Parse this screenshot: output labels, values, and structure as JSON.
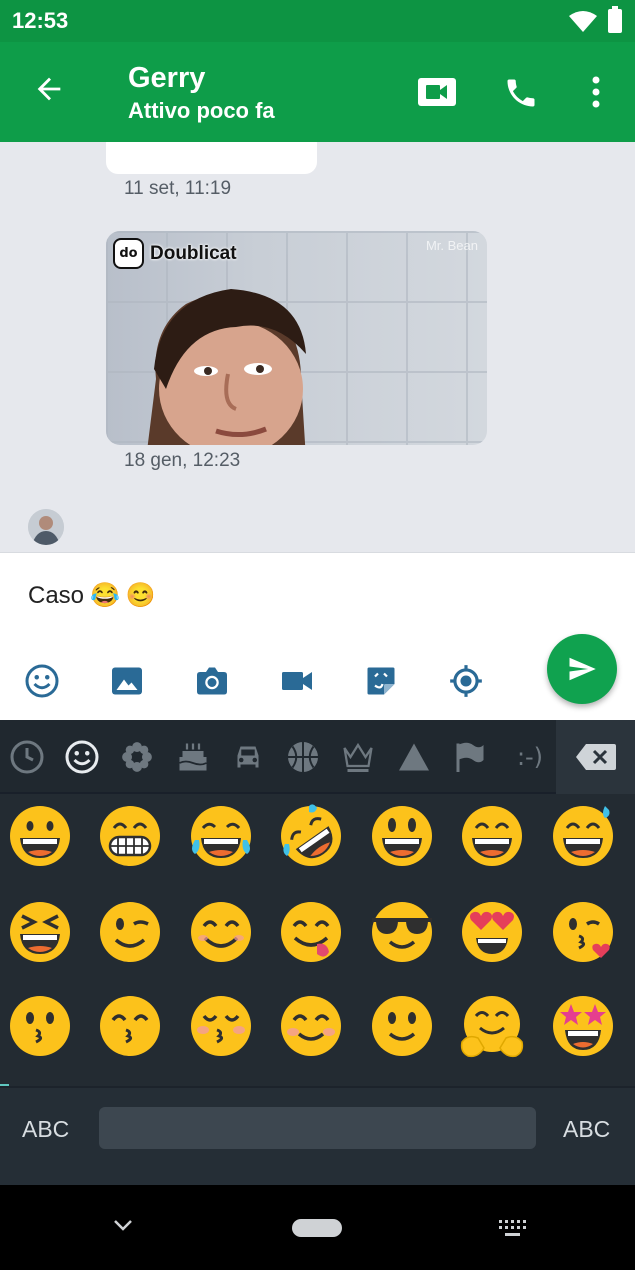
{
  "status_bar": {
    "time": "12:53"
  },
  "app_bar": {
    "contact_name": "Gerry",
    "status": "Attivo poco fa"
  },
  "messages": [
    {
      "type": "text",
      "timestamp": "11 set, 11:19"
    },
    {
      "type": "gif",
      "brand": "Doublicat",
      "brand_logo": "do",
      "watermark": "Mr. Bean",
      "timestamp": "18 gen, 12:23"
    }
  ],
  "composer": {
    "text": "Caso",
    "emojis": [
      "😂",
      "😊"
    ],
    "tools": [
      "emoji-icon",
      "image-icon",
      "camera-icon",
      "video-icon",
      "sticker-icon",
      "location-icon"
    ]
  },
  "keyboard": {
    "categories": [
      "recent",
      "smileys",
      "nature",
      "food",
      "travel",
      "activities",
      "objects",
      "symbols",
      "flags",
      "emoticons"
    ],
    "emoticon_label": ":-)",
    "emoji_rows": [
      [
        "😀",
        "😁",
        "😂",
        "🤣",
        "😃",
        "😄",
        "😅"
      ],
      [
        "😆",
        "😉",
        "😊",
        "😋",
        "😎",
        "😍",
        "😘"
      ],
      [
        "😗",
        "😙",
        "😚",
        "☺",
        "🙂",
        "🤗",
        "🤩"
      ]
    ],
    "left_label": "ABC",
    "right_label": "ABC"
  },
  "colors": {
    "app_bar": "#0e9d49",
    "send_button": "#10a24f",
    "keyboard_bg": "#232b32"
  }
}
